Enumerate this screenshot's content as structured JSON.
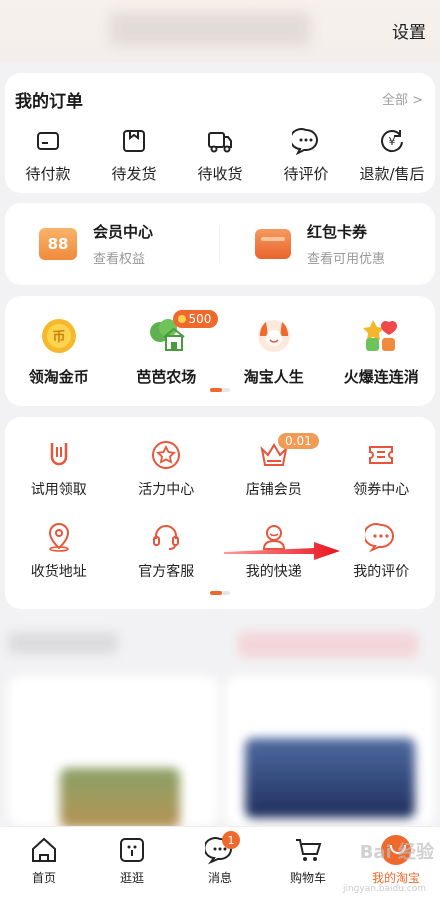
{
  "header": {
    "settings_label": "设置"
  },
  "orders": {
    "title": "我的订单",
    "all_label": "全部 >",
    "items": [
      {
        "label": "待付款",
        "icon": "card-icon"
      },
      {
        "label": "待发货",
        "icon": "box-icon"
      },
      {
        "label": "待收货",
        "icon": "truck-icon"
      },
      {
        "label": "待评价",
        "icon": "chat-icon"
      },
      {
        "label": "退款/售后",
        "icon": "refund-icon"
      }
    ]
  },
  "vip": {
    "member": {
      "title": "会员中心",
      "sub": "查看权益",
      "badge": "88"
    },
    "coupon": {
      "title": "红包卡券",
      "sub": "查看可用优惠"
    }
  },
  "games": {
    "items": [
      {
        "label": "领淘金币",
        "icon": "coin-icon"
      },
      {
        "label": "芭芭农场",
        "icon": "farm-icon",
        "badge": "500"
      },
      {
        "label": "淘宝人生",
        "icon": "character-icon"
      },
      {
        "label": "火爆连连消",
        "icon": "match-game-icon"
      }
    ]
  },
  "tools": {
    "items": [
      {
        "label": "试用领取",
        "icon": "trial-icon"
      },
      {
        "label": "活力中心",
        "icon": "star-icon"
      },
      {
        "label": "店铺会员",
        "icon": "crown-icon",
        "badge": "0.01"
      },
      {
        "label": "领券中心",
        "icon": "ticket-icon"
      },
      {
        "label": "收货地址",
        "icon": "location-icon"
      },
      {
        "label": "官方客服",
        "icon": "headset-icon"
      },
      {
        "label": "我的快递",
        "icon": "courier-icon"
      },
      {
        "label": "我的评价",
        "icon": "review-icon"
      }
    ]
  },
  "tabbar": {
    "items": [
      {
        "label": "首页",
        "icon": "home-icon"
      },
      {
        "label": "逛逛",
        "icon": "browse-icon"
      },
      {
        "label": "消息",
        "icon": "message-icon",
        "badge": "1"
      },
      {
        "label": "购物车",
        "icon": "cart-icon"
      },
      {
        "label": "我的淘宝",
        "icon": "my-taobao-icon",
        "active": true
      }
    ]
  },
  "colors": {
    "accent": "#f0692c",
    "background": "#f2f2f4"
  }
}
